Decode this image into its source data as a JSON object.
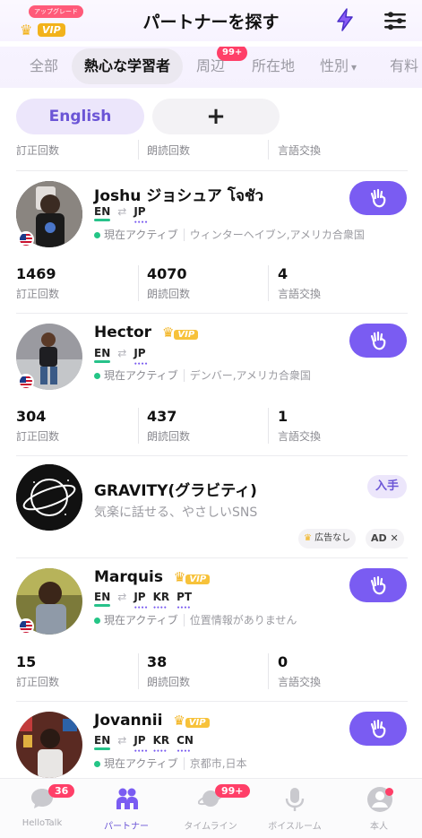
{
  "header": {
    "upgrade_badge": "アップグレード",
    "vip_label": "VIP",
    "title": "パートナーを探す"
  },
  "tabs": [
    {
      "label": "全部"
    },
    {
      "label": "熱心な学習者"
    },
    {
      "label": "周辺",
      "badge": "99+"
    },
    {
      "label": "所在地"
    },
    {
      "label": "性別"
    },
    {
      "label": "有料"
    }
  ],
  "language_filter": {
    "selected": "English",
    "add": "+"
  },
  "partial_stats": {
    "labels": [
      "訂正回数",
      "朗読回数",
      "言語交換"
    ]
  },
  "partners": [
    {
      "name": "Joshu ジョシュア โจชัว",
      "vip": false,
      "native": "EN",
      "learning": [
        "JP"
      ],
      "status": "現在アクティブ",
      "location": "ウィンターヘイブン,アメリカ合衆国",
      "stats": {
        "corrections": "1469",
        "readings": "4070",
        "exchanges": "4"
      },
      "stat_labels": {
        "corrections": "訂正回数",
        "readings": "朗読回数",
        "exchanges": "言語交換"
      }
    },
    {
      "name": "Hector",
      "vip": true,
      "vip_label": "VIP",
      "native": "EN",
      "learning": [
        "JP"
      ],
      "status": "現在アクティブ",
      "location": "デンバー,アメリカ合衆国",
      "stats": {
        "corrections": "304",
        "readings": "437",
        "exchanges": "1"
      },
      "stat_labels": {
        "corrections": "訂正回数",
        "readings": "朗読回数",
        "exchanges": "言語交換"
      }
    },
    {
      "name": "Marquis",
      "vip": true,
      "vip_label": "VIP",
      "native": "EN",
      "learning": [
        "JP",
        "KR",
        "PT"
      ],
      "status": "現在アクティブ",
      "location": "位置情報がありません",
      "stats": {
        "corrections": "15",
        "readings": "38",
        "exchanges": "0"
      },
      "stat_labels": {
        "corrections": "訂正回数",
        "readings": "朗読回数",
        "exchanges": "言語交換"
      }
    },
    {
      "name": "Jovannii",
      "vip": true,
      "vip_label": "VIP",
      "native": "EN",
      "learning": [
        "JP",
        "KR",
        "CN"
      ],
      "status": "現在アクティブ",
      "location": "京都市,日本"
    }
  ],
  "ad": {
    "title": "GRAVITY(グラビティ)",
    "subtitle": "気楽に話せる、やさしいSNS",
    "get_label": "入手",
    "no_ads_label": "広告なし",
    "vip_label": "VIP",
    "ad_label": "AD ✕"
  },
  "bottom_nav": [
    {
      "label": "HelloTalk",
      "badge": "36",
      "icon": "chat-icon"
    },
    {
      "label": "パートナー",
      "active": true,
      "icon": "partners-icon"
    },
    {
      "label": "タイムライン",
      "badge": "99+",
      "icon": "planet-icon"
    },
    {
      "label": "ボイスルーム",
      "icon": "microphone-icon"
    },
    {
      "label": "本人",
      "dot": true,
      "icon": "profile-icon"
    }
  ],
  "colors": {
    "accent": "#7a5cf2",
    "active_green": "#24c586",
    "badge_red": "#ff3f68",
    "vip_gold": "#f2b21b"
  }
}
